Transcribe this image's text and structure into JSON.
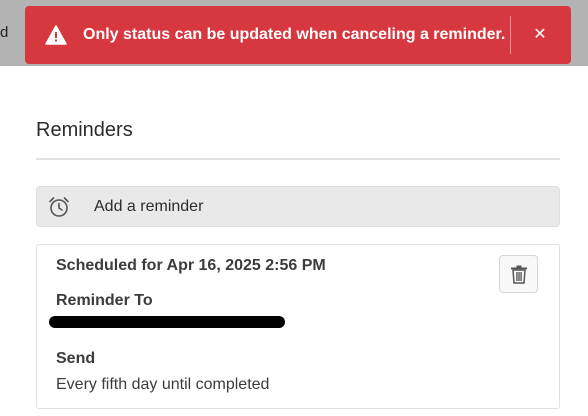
{
  "background_edge_text": "d",
  "toast": {
    "message": "Only status can be updated when canceling a reminder.",
    "icon": "alert-triangle-icon",
    "close_icon": "close-icon",
    "close_glyph": "✕",
    "color": "#d7373f"
  },
  "reminders": {
    "heading": "Reminders",
    "add_label": "Add a reminder",
    "add_icon": "alarm-clock-icon",
    "card": {
      "scheduled": "Scheduled for Apr 16, 2025 2:56 PM",
      "reminder_to_label": "Reminder To",
      "send_label": "Send",
      "send_value": "Every fifth day until completed",
      "delete_icon": "trash-icon"
    }
  }
}
